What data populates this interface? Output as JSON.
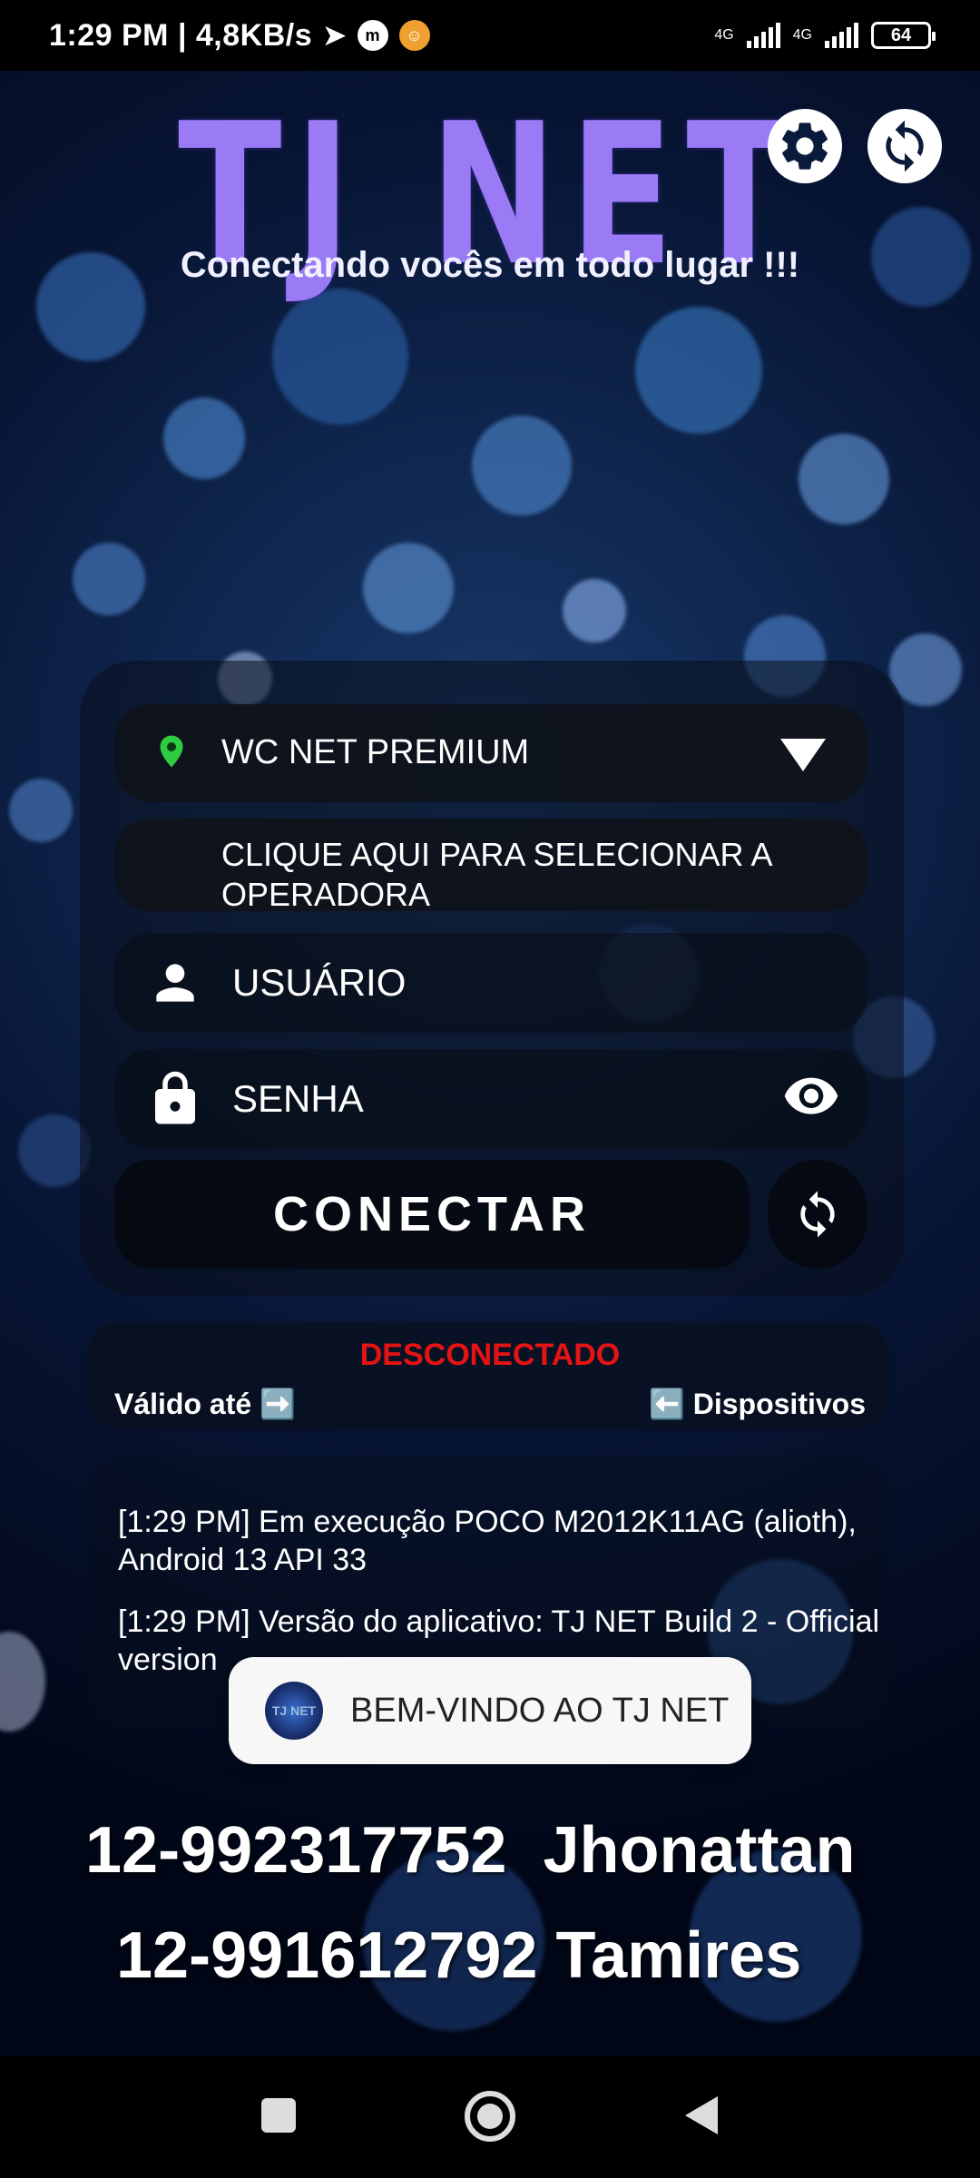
{
  "status_bar": {
    "time_speed": "1:29 PM | 4,8KB/s",
    "network_1": "4G",
    "network_2": "4G",
    "battery": "64"
  },
  "header": {
    "title": "TJ NET",
    "subtitle": "Conectando vocês em todo lugar !!!"
  },
  "top_buttons": {
    "settings_icon": "gear-icon",
    "refresh_icon": "sync-icon"
  },
  "server": {
    "name": "WC NET PREMIUM",
    "status_color": "#2ecc40"
  },
  "operator": {
    "label": "CLIQUE AQUI PARA SELECIONAR A OPERADORA"
  },
  "login": {
    "username_placeholder": "USUÁRIO",
    "password_placeholder": "SENHA"
  },
  "connect": {
    "label": "CONECTAR"
  },
  "connection_status": {
    "text": "DESCONECTADO",
    "color": "#e51414",
    "valid_until": "Válido até ➡️",
    "devices": "⬅️ Dispositivos"
  },
  "logs": [
    "[1:29 PM] Em execução POCO M2012K11AG (alioth), Android 13 API 33",
    "[1:29 PM] Versão do aplicativo: TJ NET Build 2 - Official version"
  ],
  "toast": {
    "text": "BEM-VINDO AO TJ NET",
    "logo_text": "TJ NET"
  },
  "contacts": [
    "12-992317752  Jhonattan",
    "12-991612792 Tamires"
  ]
}
